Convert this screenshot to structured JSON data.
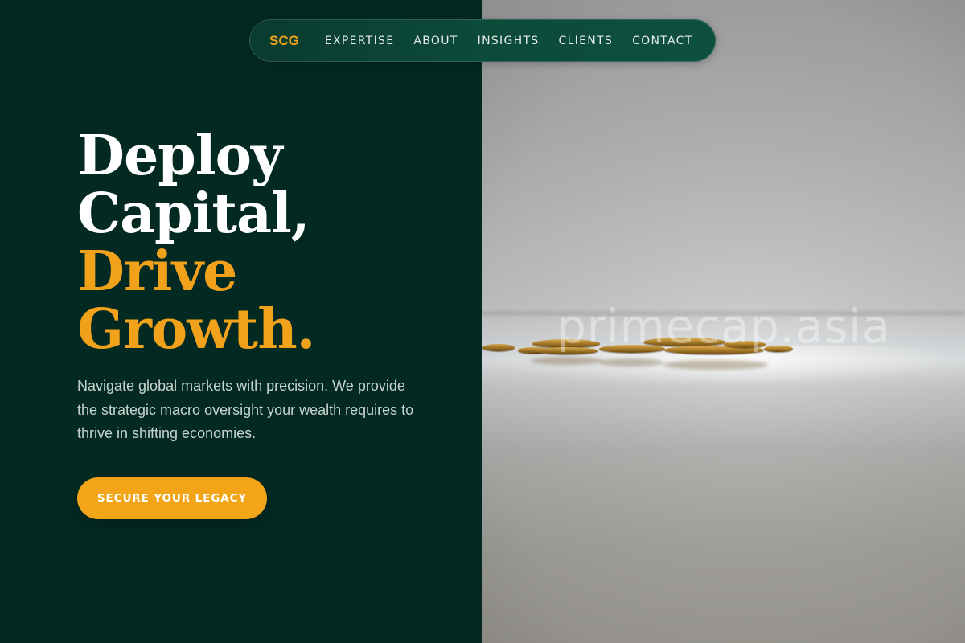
{
  "nav": {
    "logo": "SCG",
    "links": [
      "EXPERTISE",
      "ABOUT",
      "INSIGHTS",
      "CLIENTS",
      "CONTACT"
    ]
  },
  "hero": {
    "title_line1": "Deploy",
    "title_line2": "Capital,",
    "title_line3": "Drive",
    "title_line4": "Growth.",
    "description": "Navigate global markets with precision. We provide the strategic macro oversight your wealth requires to thrive in shifting economies.",
    "cta_label": "SECURE YOUR LEGACY"
  },
  "image": {
    "watermark": "primecap.asia",
    "subject": "gold coins on reflective surface"
  },
  "colors": {
    "background": "#022a22",
    "accent": "#f4a517",
    "nav_background": "#0c4a3a",
    "text_light": "#ffffff",
    "text_muted": "#c7d3cd"
  }
}
